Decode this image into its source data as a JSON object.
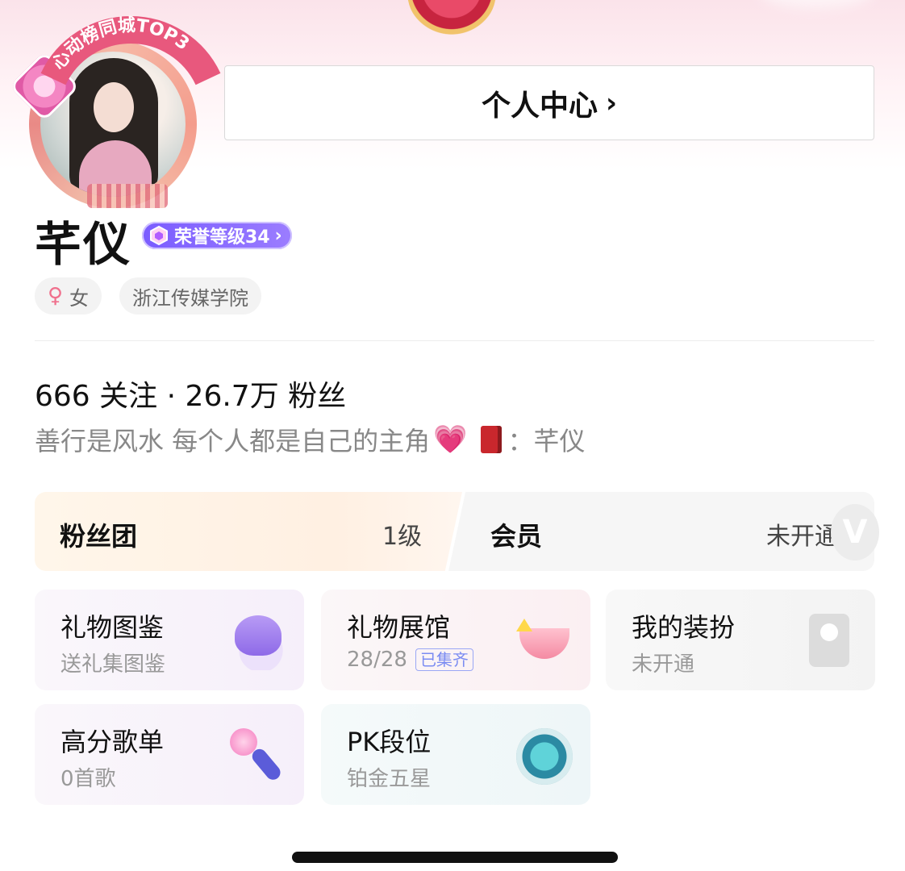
{
  "profile": {
    "avatar_badge": "心动榜同城TOP3",
    "center_button": "个人中心",
    "name": "芊仪",
    "level_badge": "荣誉等级34",
    "gender": "女",
    "school": "浙江传媒学院",
    "following_count": "666",
    "following_label": "关注",
    "separator": "·",
    "fans_count": "26.7万",
    "fans_label": "粉丝",
    "bio_text": "善行是风水 每个人都是自己的主角",
    "bio_suffix": "：芊仪"
  },
  "fan_bar": {
    "fan_club_label": "粉丝团",
    "fan_club_level": "1级",
    "member_label": "会员",
    "member_status": "未开通"
  },
  "cards": [
    {
      "title": "礼物图鉴",
      "subtitle": "送礼集图鉴",
      "icon": "purple-heart-icon"
    },
    {
      "title": "礼物展馆",
      "subtitle": "28/28",
      "badge": "已集齐",
      "icon": "pink-bowl-icon"
    },
    {
      "title": "我的装扮",
      "subtitle": "未开通",
      "icon": "id-card-icon"
    },
    {
      "title": "高分歌单",
      "subtitle": "0首歌",
      "icon": "microphone-icon"
    },
    {
      "title": "PK段位",
      "subtitle": "铂金五星",
      "icon": "pk-rank-badge-icon"
    }
  ],
  "colors": {
    "level_badge": "#8a6cff",
    "female_icon": "#f0708d",
    "collected_badge": "#7b8cf2"
  }
}
